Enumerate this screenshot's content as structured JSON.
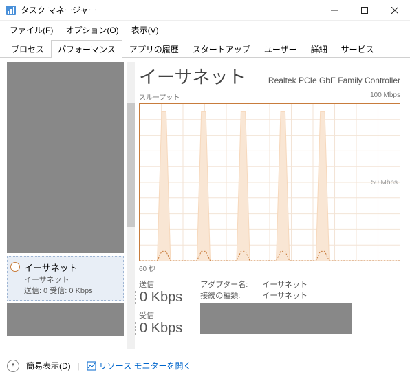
{
  "window": {
    "title": "タスク マネージャー"
  },
  "menu": {
    "file": "ファイル(F)",
    "options": "オプション(O)",
    "view": "表示(V)"
  },
  "tabs": {
    "processes": "プロセス",
    "performance": "パフォーマンス",
    "app_history": "アプリの履歴",
    "startup": "スタートアップ",
    "users": "ユーザー",
    "details": "詳細",
    "services": "サービス"
  },
  "sidebar": {
    "selected": {
      "title": "イーサネット",
      "subtitle": "イーサネット",
      "detail": "送信: 0 受信: 0 Kbps"
    }
  },
  "main": {
    "title": "イーサネット",
    "adapter": "Realtek PCIe GbE Family Controller",
    "chart_label_left": "スループット",
    "chart_label_right": "100 Mbps",
    "chart_mid_label": "50 Mbps",
    "chart_x_label": "60 秒",
    "send_label": "送信",
    "send_value": "0 Kbps",
    "recv_label": "受信",
    "recv_value": "0 Kbps",
    "adapter_name_label": "アダプター名:",
    "adapter_name_value": "イーサネット",
    "conn_type_label": "接続の種類:",
    "conn_type_value": "イーサネット"
  },
  "footer": {
    "simple": "簡易表示(D)",
    "resmon": "リソース モニターを開く"
  },
  "chart_data": {
    "type": "area",
    "title": "スループット",
    "ylabel": "Mbps",
    "ylim": [
      0,
      100
    ],
    "x_range_seconds": 60,
    "series": [
      {
        "name": "受信",
        "color": "#f6d6b8",
        "values": [
          0,
          0,
          0,
          0,
          0,
          95,
          95,
          0,
          0,
          0,
          0,
          0,
          0,
          0,
          95,
          95,
          0,
          0,
          0,
          0,
          0,
          0,
          0,
          95,
          95,
          0,
          0,
          0,
          0,
          0,
          0,
          0,
          95,
          95,
          0,
          0,
          0,
          0,
          0,
          0,
          0,
          95,
          95,
          0,
          0,
          0,
          0,
          0,
          0,
          0,
          0,
          0,
          0,
          0,
          0,
          0,
          0,
          0,
          0,
          0
        ]
      },
      {
        "name": "送信",
        "color": "#c87c3c",
        "values": [
          0,
          0,
          0,
          0,
          0,
          6,
          6,
          0,
          0,
          0,
          0,
          0,
          0,
          0,
          6,
          6,
          0,
          0,
          0,
          0,
          0,
          0,
          0,
          6,
          6,
          0,
          0,
          0,
          0,
          0,
          0,
          0,
          6,
          6,
          0,
          0,
          0,
          0,
          0,
          0,
          0,
          6,
          6,
          0,
          0,
          0,
          0,
          0,
          0,
          0,
          0,
          0,
          0,
          0,
          0,
          0,
          0,
          0,
          0,
          0
        ]
      }
    ]
  }
}
